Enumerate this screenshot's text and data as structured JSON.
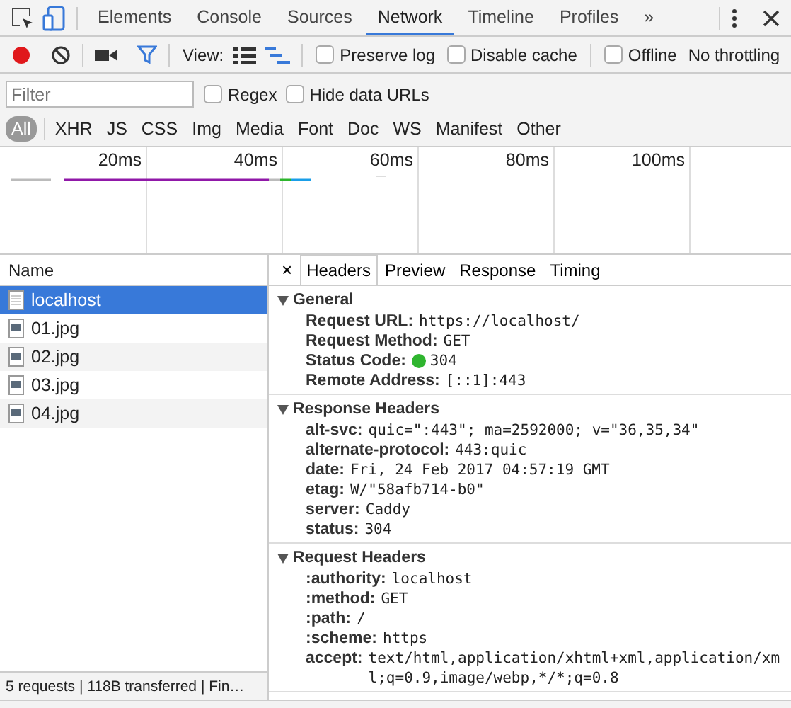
{
  "panel_tabs": [
    {
      "label": "Elements",
      "selected": false
    },
    {
      "label": "Console",
      "selected": false
    },
    {
      "label": "Sources",
      "selected": false
    },
    {
      "label": "Network",
      "selected": true
    },
    {
      "label": "Timeline",
      "selected": false
    },
    {
      "label": "Profiles",
      "selected": false
    }
  ],
  "more_tabs": "»",
  "toolbar": {
    "recording": true,
    "filter_active": true,
    "view_label": "View:",
    "views": [
      {
        "kind": "rows",
        "selected": false
      },
      {
        "kind": "waterfall",
        "selected": true
      }
    ],
    "checkboxes": [
      {
        "label": "Preserve log",
        "checked": false
      },
      {
        "label": "Disable cache",
        "checked": false
      },
      {
        "label": "Offline",
        "checked": false
      }
    ],
    "throttling": "No throttling"
  },
  "filter": {
    "placeholder": "Filter",
    "options": [
      {
        "label": "Regex",
        "checked": false
      },
      {
        "label": "Hide data URLs",
        "checked": false
      }
    ]
  },
  "types": [
    {
      "label": "All",
      "selected": true
    },
    {
      "label": "XHR",
      "selected": false
    },
    {
      "label": "JS",
      "selected": false
    },
    {
      "label": "CSS",
      "selected": false
    },
    {
      "label": "Img",
      "selected": false
    },
    {
      "label": "Media",
      "selected": false
    },
    {
      "label": "Font",
      "selected": false
    },
    {
      "label": "Doc",
      "selected": false
    },
    {
      "label": "WS",
      "selected": false
    },
    {
      "label": "Manifest",
      "selected": false
    },
    {
      "label": "Other",
      "selected": false
    }
  ],
  "overview": {
    "ticks": [
      "20ms",
      "40ms",
      "60ms",
      "80ms",
      "100ms"
    ]
  },
  "requests": {
    "column": "Name",
    "rows": [
      {
        "name": "localhost",
        "kind": "document",
        "selected": true
      },
      {
        "name": "01.jpg",
        "kind": "image",
        "selected": false
      },
      {
        "name": "02.jpg",
        "kind": "image",
        "selected": false
      },
      {
        "name": "03.jpg",
        "kind": "image",
        "selected": false
      },
      {
        "name": "04.jpg",
        "kind": "image",
        "selected": false
      }
    ],
    "status": "5 requests | 118B transferred | Fin…"
  },
  "details": {
    "close": "×",
    "tabs": [
      {
        "label": "Headers",
        "selected": true
      },
      {
        "label": "Preview",
        "selected": false
      },
      {
        "label": "Response",
        "selected": false
      },
      {
        "label": "Timing",
        "selected": false
      }
    ],
    "sections": [
      {
        "title": "General",
        "expanded": true,
        "rows": [
          {
            "name": "Request URL:",
            "value": "https://localhost/"
          },
          {
            "name": "Request Method:",
            "value": "GET"
          },
          {
            "name": "Status Code:",
            "value": "304",
            "color": "#2fb52f"
          },
          {
            "name": "Remote Address:",
            "value": "[::1]:443"
          }
        ]
      },
      {
        "title": "Response Headers",
        "expanded": true,
        "rows": [
          {
            "name": "alt-svc:",
            "value": "quic=\":443\"; ma=2592000; v=\"36,35,34\""
          },
          {
            "name": "alternate-protocol:",
            "value": "443:quic"
          },
          {
            "name": "date:",
            "value": "Fri, 24 Feb 2017 04:57:19 GMT"
          },
          {
            "name": "etag:",
            "value": "W/\"58afb714-b0\""
          },
          {
            "name": "server:",
            "value": "Caddy"
          },
          {
            "name": "status:",
            "value": "304"
          }
        ]
      },
      {
        "title": "Request Headers",
        "expanded": true,
        "rows": [
          {
            "name": ":authority:",
            "value": "localhost"
          },
          {
            "name": ":method:",
            "value": "GET"
          },
          {
            "name": ":path:",
            "value": "/"
          },
          {
            "name": ":scheme:",
            "value": "https"
          },
          {
            "name": "accept:",
            "value": "text/html,application/xhtml+xml,application/xml;q=0.9,image/webp,*/*;q=0.8"
          }
        ]
      }
    ]
  }
}
